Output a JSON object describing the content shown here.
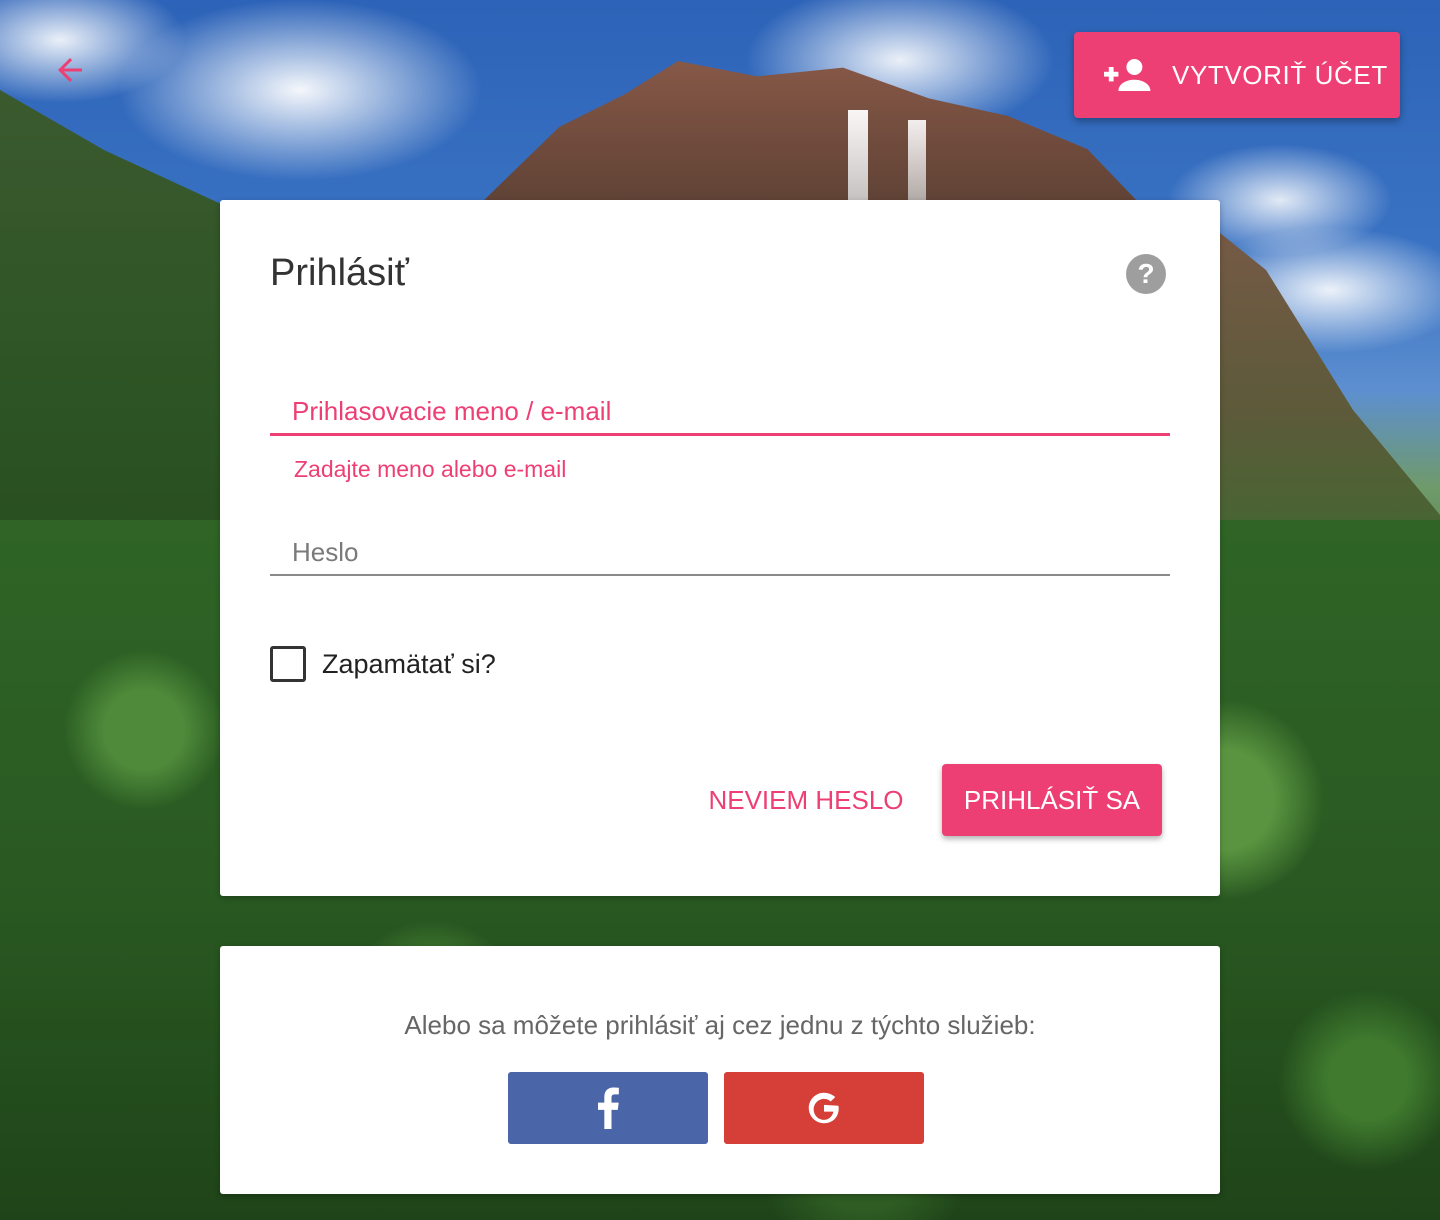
{
  "topbar": {
    "back_icon": "arrow-back-icon",
    "create_account_label": "VYTVORIŤ ÚČET",
    "create_account_icon": "person-add-icon"
  },
  "login": {
    "title": "Prihlásiť",
    "help_icon": "help-icon",
    "username_placeholder": "Prihlasovacie meno / e-mail",
    "username_error": "Zadajte meno alebo e-mail",
    "password_placeholder": "Heslo",
    "remember_label": "Zapamätať si?",
    "forgot_label": "NEVIEM HESLO",
    "submit_label": "PRIHLÁSIŤ SA"
  },
  "social": {
    "text": "Alebo sa môžete prihlásiť aj cez jednu z týchto služieb:",
    "facebook_icon": "facebook-icon",
    "google_icon": "google-icon"
  },
  "colors": {
    "accent": "#ee3f74",
    "facebook": "#4a66a8",
    "google": "#d63f38"
  }
}
